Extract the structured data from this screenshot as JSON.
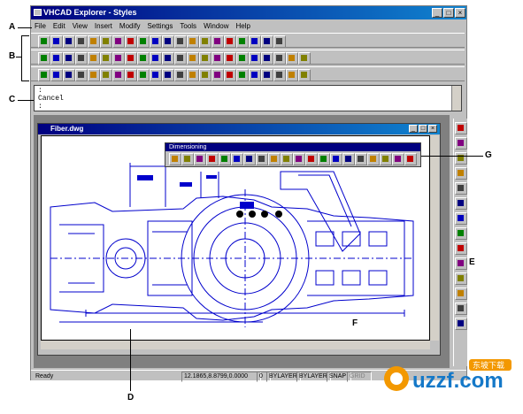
{
  "window": {
    "title": "VHCAD Explorer - Styles",
    "minimize": "_",
    "maximize": "□",
    "close": "×"
  },
  "menu": [
    "File",
    "Edit",
    "View",
    "Insert",
    "Modify",
    "Settings",
    "Tools",
    "Window",
    "Help"
  ],
  "command_line": {
    "line1": ":",
    "line2": "Cancel",
    "line3": ":"
  },
  "document": {
    "title": "Fiber.dwg"
  },
  "floating_toolbar": {
    "title": "Dimensioning"
  },
  "status": {
    "ready": "Ready",
    "coords": "12.1865,8.8799,0.0000",
    "layer_index": "0",
    "color": "BYLAYER",
    "linetype": "BYLAYER",
    "snap": "SNAP",
    "grid": "GRID"
  },
  "callouts": [
    "A",
    "B",
    "C",
    "D",
    "E",
    "F",
    "G"
  ],
  "watermark": {
    "text": "uzzf.com",
    "sub": "东坡下载"
  },
  "colors": {
    "title_bar": "#000080",
    "drawing_lines": "#0000cc",
    "watermark_orange": "#f39800",
    "watermark_blue": "#1478c8"
  }
}
